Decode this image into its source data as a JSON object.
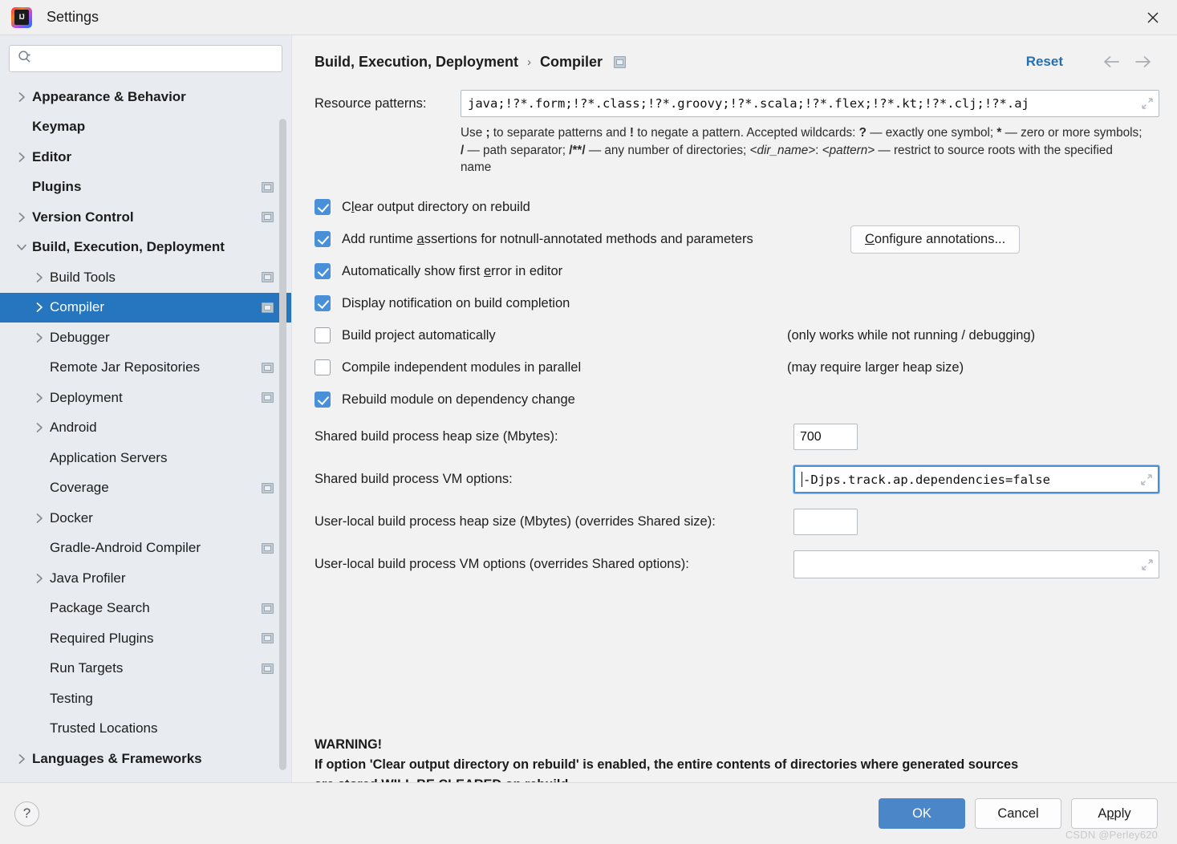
{
  "window": {
    "title": "Settings",
    "app_icon": "intellij-idea-icon",
    "close_icon": "close-icon"
  },
  "sidebar": {
    "search": {
      "icon": "search-icon",
      "value": "",
      "placeholder": ""
    },
    "items": [
      {
        "label": "Appearance & Behavior",
        "level": 0,
        "chevron": "chevron-right-icon",
        "badge": false,
        "selected": false
      },
      {
        "label": "Keymap",
        "level": 0,
        "chevron": "",
        "badge": false,
        "selected": false
      },
      {
        "label": "Editor",
        "level": 0,
        "chevron": "chevron-right-icon",
        "badge": false,
        "selected": false
      },
      {
        "label": "Plugins",
        "level": 0,
        "chevron": "",
        "badge": true,
        "selected": false
      },
      {
        "label": "Version Control",
        "level": 0,
        "chevron": "chevron-right-icon",
        "badge": true,
        "selected": false
      },
      {
        "label": "Build, Execution, Deployment",
        "level": 0,
        "chevron": "chevron-down-icon",
        "badge": false,
        "selected": false
      },
      {
        "label": "Build Tools",
        "level": 1,
        "chevron": "chevron-right-icon",
        "badge": true,
        "selected": false
      },
      {
        "label": "Compiler",
        "level": 1,
        "chevron": "chevron-right-icon",
        "badge": true,
        "selected": true
      },
      {
        "label": "Debugger",
        "level": 1,
        "chevron": "chevron-right-icon",
        "badge": false,
        "selected": false
      },
      {
        "label": "Remote Jar Repositories",
        "level": 1,
        "chevron": "",
        "badge": true,
        "selected": false
      },
      {
        "label": "Deployment",
        "level": 1,
        "chevron": "chevron-right-icon",
        "badge": true,
        "selected": false
      },
      {
        "label": "Android",
        "level": 1,
        "chevron": "chevron-right-icon",
        "badge": false,
        "selected": false
      },
      {
        "label": "Application Servers",
        "level": 1,
        "chevron": "",
        "badge": false,
        "selected": false
      },
      {
        "label": "Coverage",
        "level": 1,
        "chevron": "",
        "badge": true,
        "selected": false
      },
      {
        "label": "Docker",
        "level": 1,
        "chevron": "chevron-right-icon",
        "badge": false,
        "selected": false
      },
      {
        "label": "Gradle-Android Compiler",
        "level": 1,
        "chevron": "",
        "badge": true,
        "selected": false
      },
      {
        "label": "Java Profiler",
        "level": 1,
        "chevron": "chevron-right-icon",
        "badge": false,
        "selected": false
      },
      {
        "label": "Package Search",
        "level": 1,
        "chevron": "",
        "badge": true,
        "selected": false
      },
      {
        "label": "Required Plugins",
        "level": 1,
        "chevron": "",
        "badge": true,
        "selected": false
      },
      {
        "label": "Run Targets",
        "level": 1,
        "chevron": "",
        "badge": true,
        "selected": false
      },
      {
        "label": "Testing",
        "level": 1,
        "chevron": "",
        "badge": false,
        "selected": false
      },
      {
        "label": "Trusted Locations",
        "level": 1,
        "chevron": "",
        "badge": false,
        "selected": false
      },
      {
        "label": "Languages & Frameworks",
        "level": 0,
        "chevron": "chevron-right-icon",
        "badge": false,
        "selected": false
      }
    ]
  },
  "header": {
    "breadcrumb_root": "Build, Execution, Deployment",
    "breadcrumb_sep": "›",
    "breadcrumb_leaf": "Compiler",
    "reset_label": "Reset",
    "back_icon": "arrow-left-icon",
    "forward_icon": "arrow-right-icon"
  },
  "main": {
    "resource_patterns": {
      "label": "Resource patterns:",
      "value": "java;!?*.form;!?*.class;!?*.groovy;!?*.scala;!?*.flex;!?*.kt;!?*.clj;!?*.aj",
      "expand_icon": "expand-icon"
    },
    "help_text_html": "Use <b>;</b> to separate patterns and <b>!</b> to negate a pattern. Accepted wildcards: <b>?</b> &mdash; exactly one symbol; <b>*</b> &mdash; zero or more symbols; <b>/</b> &mdash; path separator; <b>/**/</b> &mdash; any number of directories; <i>&lt;dir_name&gt;</i>: <i>&lt;pattern&gt;</i> &mdash; restrict to source roots with the specified name",
    "checkboxes": [
      {
        "label_html": "C<u>l</u>ear output directory on rebuild",
        "checked": true,
        "note": "",
        "button": ""
      },
      {
        "label_html": "Add runtime <u>a</u>ssertions for notnull-annotated methods and parameters",
        "checked": true,
        "note": "",
        "button": "<u>C</u>onfigure annotations..."
      },
      {
        "label_html": "Automatically show first <u>e</u>rror in editor",
        "checked": true,
        "note": "",
        "button": ""
      },
      {
        "label_html": "Display notification on build completion",
        "checked": true,
        "note": "",
        "button": ""
      },
      {
        "label_html": "Build project automatically",
        "checked": false,
        "note": "(only works while not running / debugging)",
        "button": ""
      },
      {
        "label_html": "Compile independent modules in parallel",
        "checked": false,
        "note": "(may require larger heap size)",
        "button": ""
      },
      {
        "label_html": "Rebuild module on dependency change",
        "checked": true,
        "note": "",
        "button": ""
      }
    ],
    "fields": [
      {
        "label": "Shared build process heap size (Mbytes):",
        "value": "700",
        "kind": "small",
        "focused": false
      },
      {
        "label": "Shared build process VM options:",
        "value": "-Djps.track.ap.dependencies=false",
        "kind": "wide",
        "focused": true
      },
      {
        "label": "User-local build process heap size (Mbytes) (overrides Shared size):",
        "value": "",
        "kind": "small",
        "focused": false
      },
      {
        "label": "User-local build process VM options (overrides Shared options):",
        "value": "",
        "kind": "wide",
        "focused": false
      }
    ],
    "warning_title": "WARNING!",
    "warning_line1": "If option 'Clear output directory on rebuild' is enabled, the entire contents of directories where generated sources",
    "warning_line2": "are stored WILL BE CLEARED on rebuild."
  },
  "footer": {
    "help_label": "?",
    "ok_label": "OK",
    "cancel_label": "Cancel",
    "apply_label_html": "A<u>p</u>ply",
    "watermark": "CSDN @Perley620"
  },
  "colors": {
    "accent": "#4a90d9",
    "selection": "#2675bf",
    "link": "#2470b3",
    "sidebar_bg": "#e8ecf0",
    "panel_bg": "#f2f2f2",
    "primary_button": "#4a86c8"
  }
}
